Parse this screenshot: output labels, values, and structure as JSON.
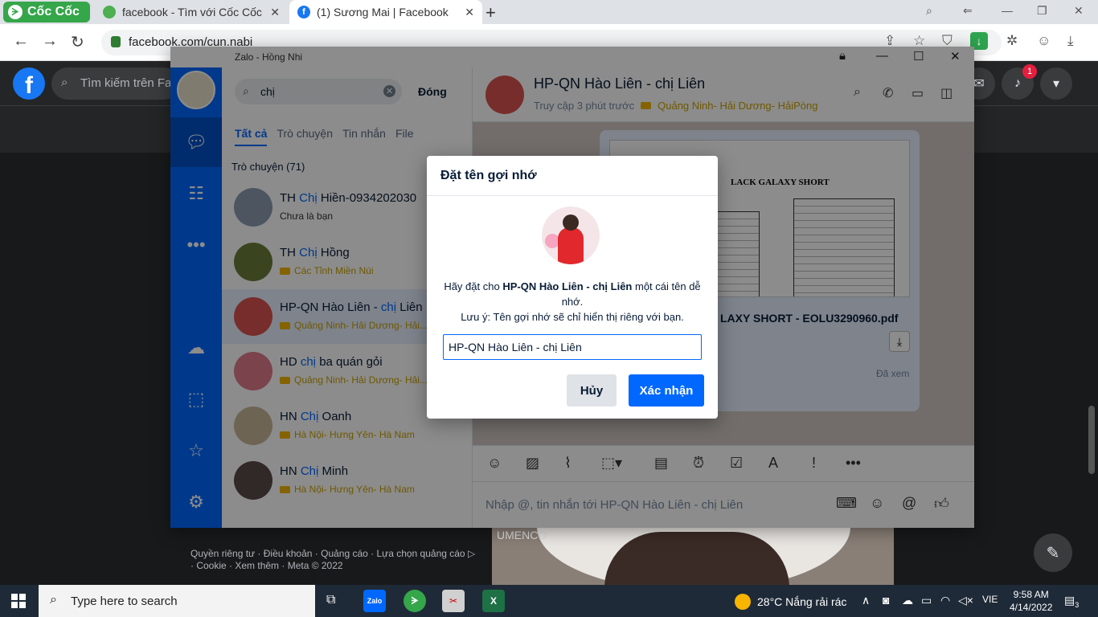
{
  "browser": {
    "brand": "Cốc Cốc",
    "tabs": [
      {
        "title": "facebook - Tìm với Cốc Cốc"
      },
      {
        "title": "(1) Sương Mai | Facebook"
      }
    ],
    "url": "facebook.com/cun.nabi"
  },
  "facebook": {
    "search_placeholder": "Tìm kiếm trên Fac",
    "notification_count": "1",
    "footer": "Quyền riêng tư · Điều khoản · Quảng cáo · Lựa chọn quảng cáo ▷ · Cookie · Xem thêm · Meta © 2022",
    "photo_sign": "UMENCO"
  },
  "zalo": {
    "window_title": "Zalo - Hồng Nhi",
    "search_value": "chị",
    "close_search": "Đóng",
    "tabs": [
      "Tất cả",
      "Trò chuyện",
      "Tin nhắn",
      "File"
    ],
    "section_title": "Trò chuyện (71)",
    "conversations": [
      {
        "prefix": "TH ",
        "hl": "Chị",
        "suffix": " Hiền-0934202030",
        "sub": "Chưa là bạn",
        "color": "#8a9bb0"
      },
      {
        "prefix": "TH ",
        "hl": "Chị",
        "suffix": " Hồng",
        "sub": "Các Tỉnh Miền Núi",
        "color": "#6b7d3a"
      },
      {
        "prefix": "HP-QN Hào Liên - ",
        "hl": "chị",
        "suffix": " Liên",
        "sub": "Quảng Ninh- Hải Dương- Hải...",
        "color": "#d9534f"
      },
      {
        "prefix": "HD ",
        "hl": "chị",
        "suffix": " ba quán gỏi",
        "sub": "Quảng Ninh- Hải Dương- Hải...",
        "color": "#e07a8a"
      },
      {
        "prefix": "HN ",
        "hl": "Chị",
        "suffix": " Oanh",
        "sub": "Hà Nội- Hưng Yên- Hà Nam",
        "color": "#c9b79a"
      },
      {
        "prefix": "HN ",
        "hl": "Chị",
        "suffix": " Minh",
        "sub": "Hà Nội- Hưng Yên- Hà Nam",
        "color": "#5a4a4a"
      }
    ],
    "chat": {
      "title": "HP-QN Hào Liên - chị Liên",
      "last_seen": "Truy cập 3 phút trước",
      "label": "Quảng Ninh- Hải Dương- HảiPòng",
      "doc_heading": "LACK GALAXY SHORT",
      "file_name": "LAXY SHORT - EOLU3290960.pdf",
      "seen": "Đã xem",
      "input_placeholder": "Nhập @, tin nhắn tới HP-QN Hào Liên - chị Liên"
    }
  },
  "modal": {
    "title": "Đặt tên gợi nhớ",
    "line1_pre": "Hãy đặt cho ",
    "line1_name": "HP-QN Hào Liên - chị Liên",
    "line1_post": " một cái tên dễ nhớ.",
    "line2": "Lưu ý: Tên gợi nhớ sẽ chỉ hiển thị riêng với bạn.",
    "input_value": "HP-QN Hào Liên - chị Liên",
    "cancel": "Hủy",
    "confirm": "Xác nhận"
  },
  "taskbar": {
    "search_placeholder": "Type here to search",
    "weather": "28°C  Nắng rải rác",
    "lang": "VIE",
    "time": "9:58 AM",
    "date": "4/14/2022",
    "notif": "3",
    "apps": [
      "Zalo",
      "Cốc Cốc",
      "Snipping",
      "Excel"
    ]
  },
  "colors": {
    "accent": "#0068ff",
    "fb": "#1877f2"
  }
}
